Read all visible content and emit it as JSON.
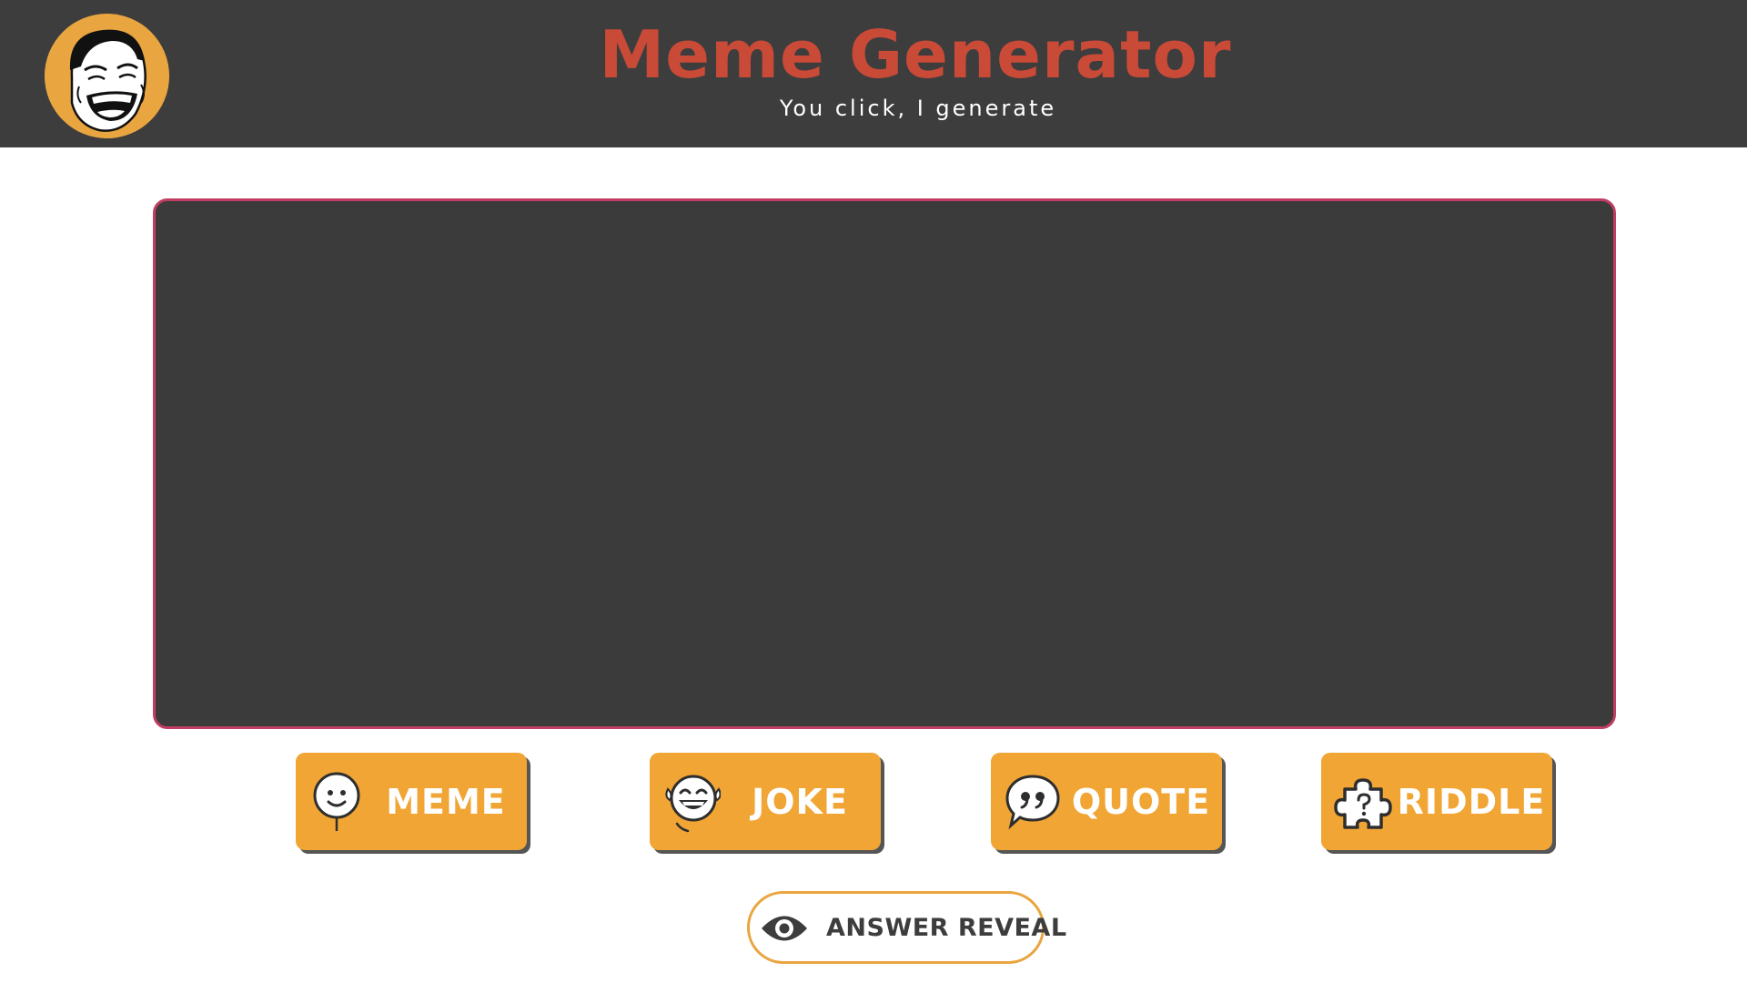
{
  "header": {
    "title": "Meme Generator",
    "subtitle": "You click, I generate",
    "logo_icon": "laughing-face-logo-icon"
  },
  "display": {
    "content": ""
  },
  "buttons": [
    {
      "id": "meme",
      "label": "MEME",
      "icon": "smiley-balloon-icon"
    },
    {
      "id": "joke",
      "label": "JOKE",
      "icon": "laughing-emoji-icon"
    },
    {
      "id": "quote",
      "label": "QUOTE",
      "icon": "quote-bubble-icon"
    },
    {
      "id": "riddle",
      "label": "RIDDLE",
      "icon": "puzzle-question-icon"
    }
  ],
  "reveal": {
    "label": "ANSWER REVEAL",
    "icon": "eye-icon"
  },
  "colors": {
    "header_bg": "#3d3d3d",
    "title": "#c94a37",
    "accent": "#f0a535",
    "display_bg": "#3b3b3b",
    "display_border": "#c13d63"
  }
}
